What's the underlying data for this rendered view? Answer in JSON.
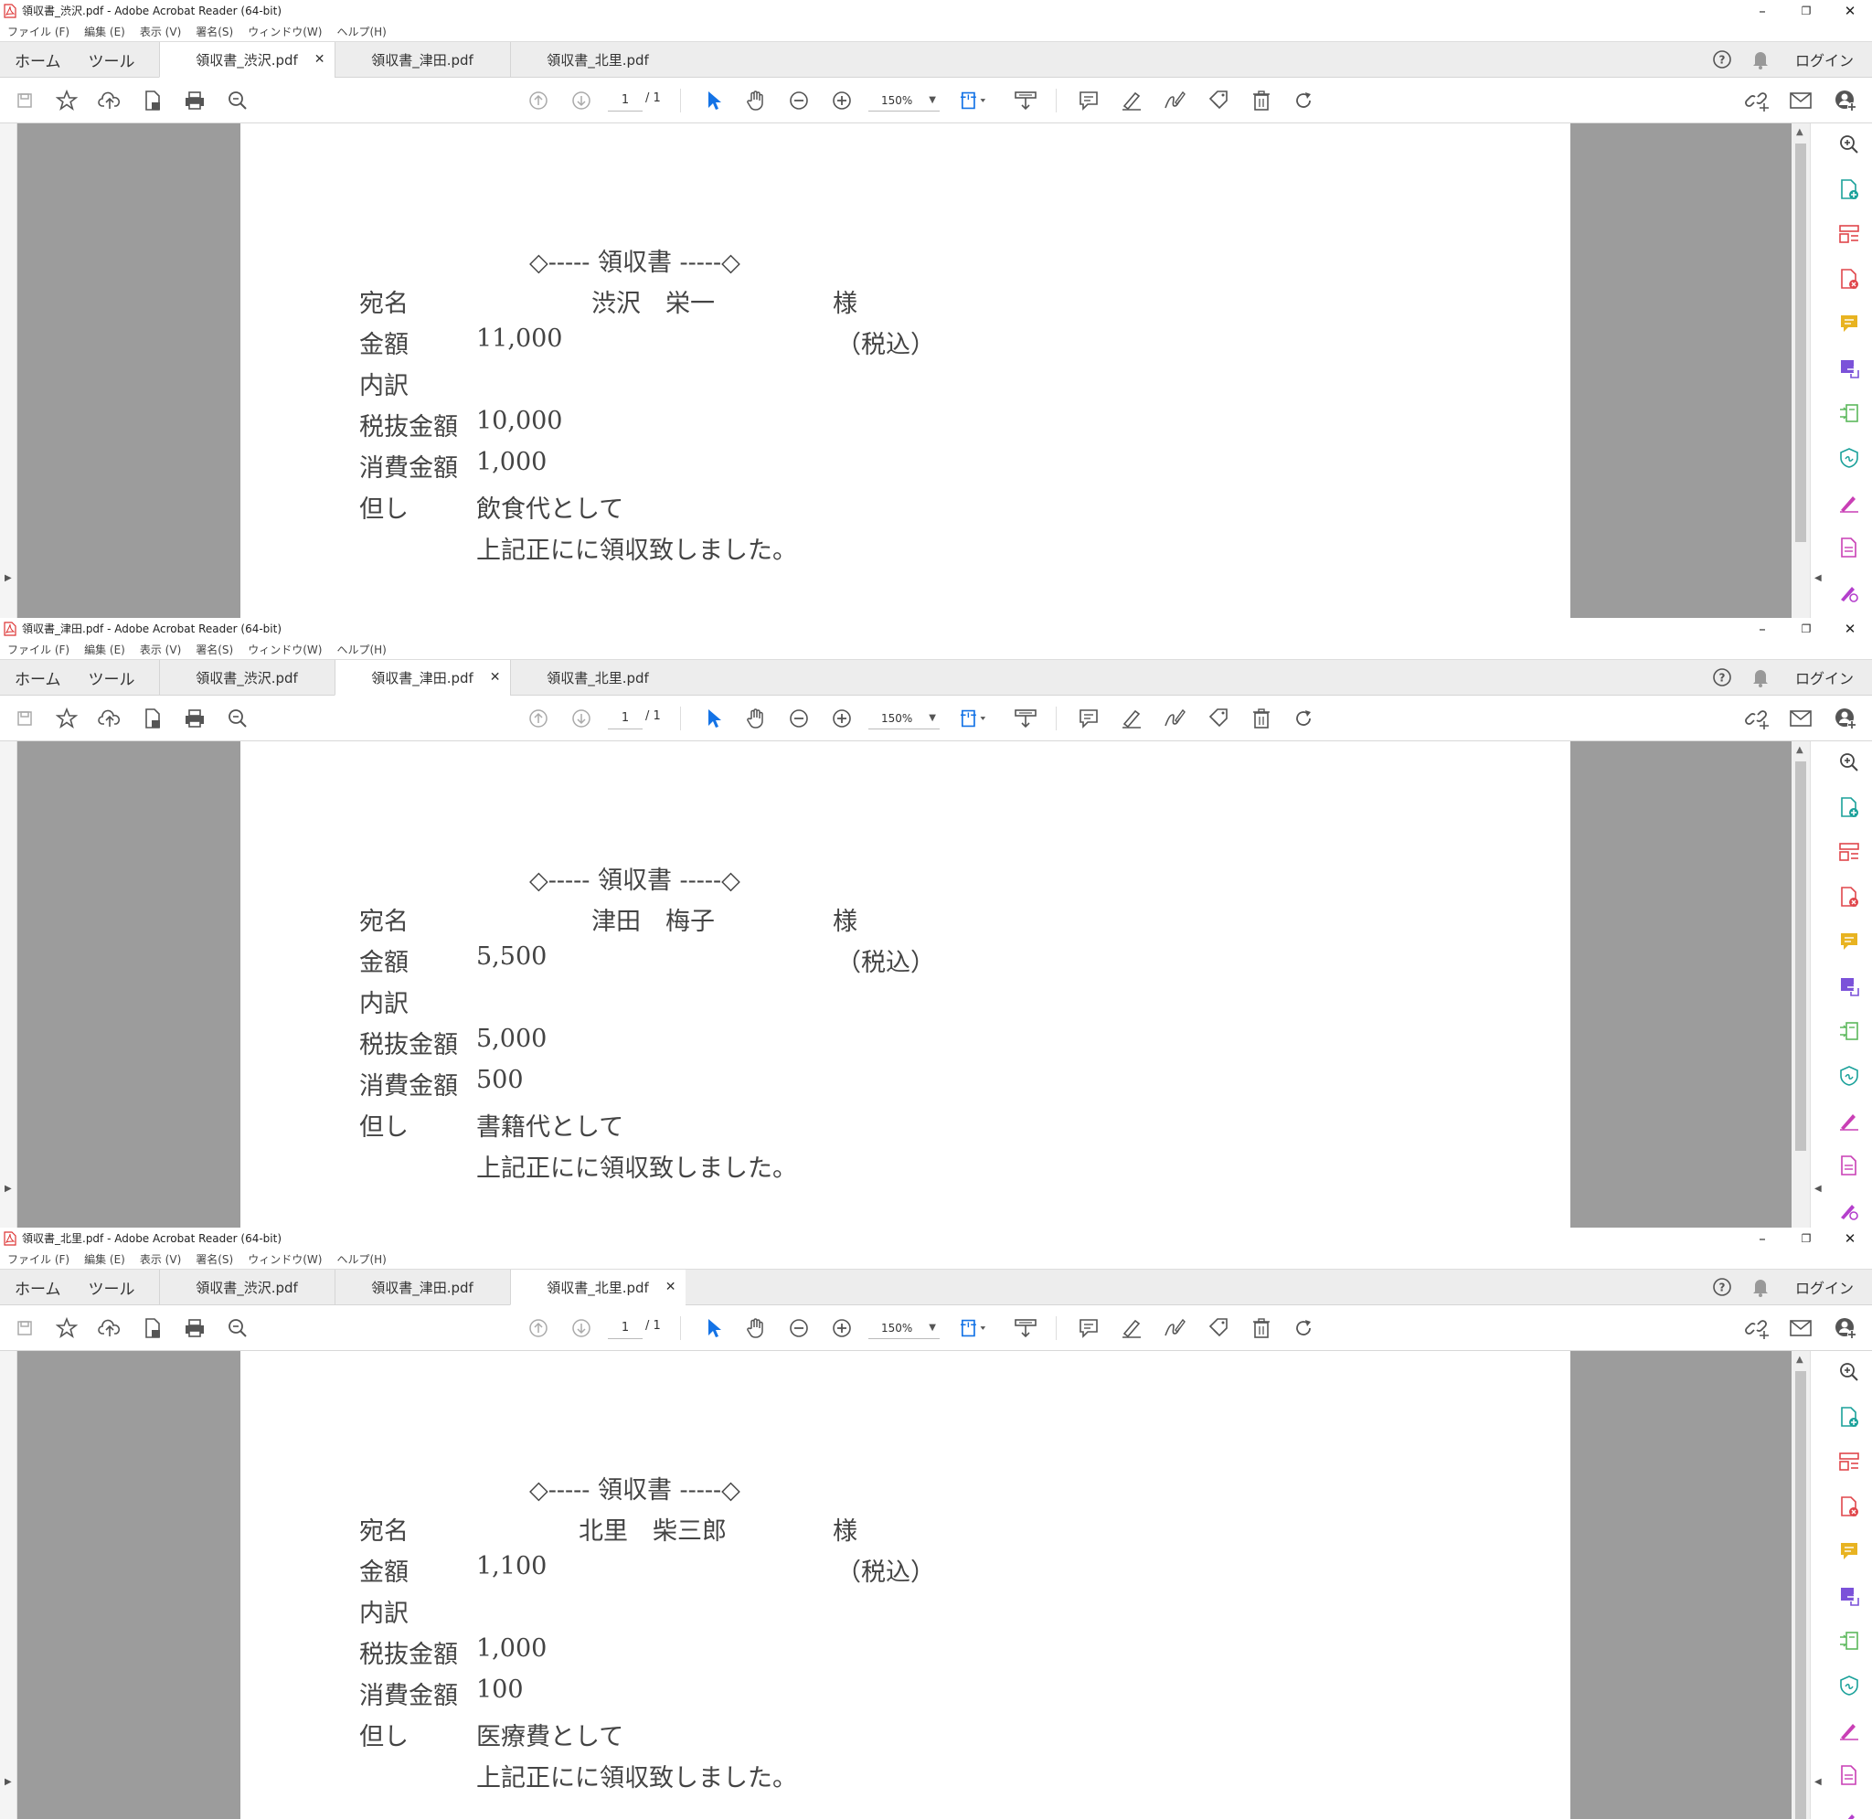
{
  "windows": [
    {
      "title": "領収書_渋沢.pdf - Adobe Acrobat Reader (64-bit)",
      "active_tab": 0,
      "receipt": {
        "name": "渋沢　栄一",
        "amount": "11,000",
        "pretax": "10,000",
        "tax": "1,000",
        "purpose": "飲食代として"
      }
    },
    {
      "title": "領収書_津田.pdf - Adobe Acrobat Reader (64-bit)",
      "active_tab": 1,
      "receipt": {
        "name": "津田　梅子",
        "amount": "5,500",
        "pretax": "5,000",
        "tax": "500",
        "purpose": "書籍代として"
      }
    },
    {
      "title": "領収書_北里.pdf - Adobe Acrobat Reader (64-bit)",
      "active_tab": 2,
      "receipt": {
        "name": "北里　柴三郎",
        "amount": "1,100",
        "pretax": "1,000",
        "tax": "100",
        "purpose": "医療費として"
      }
    }
  ],
  "menu": [
    "ファイル (F)",
    "編集 (E)",
    "表示 (V)",
    "署名(S)",
    "ウィンドウ(W)",
    "ヘルプ(H)"
  ],
  "nav": {
    "home": "ホーム",
    "tools": "ツール",
    "login": "ログイン"
  },
  "tabs": [
    "領収書_渋沢.pdf",
    "領収書_津田.pdf",
    "領収書_北里.pdf"
  ],
  "toolbar": {
    "page_current": "1",
    "page_total": "/ 1",
    "zoom": "150%"
  },
  "receipt_labels": {
    "title": "◇----- 領収書 -----◇",
    "addressee": "宛名",
    "honorific": "様",
    "amount": "金額",
    "tax_included": "（税込）",
    "breakdown": "内訳",
    "pretax": "税抜金額",
    "tax": "消費金額",
    "purpose": "但し",
    "closing": "上記正にに領収致しました。"
  },
  "window_controls": {
    "minimize": "–",
    "restore": "❐",
    "close": "✕"
  },
  "colors": {
    "accent_blue": "#1473e6",
    "teal": "#1aa19a",
    "red": "#e0464b",
    "yellow": "#e8b321",
    "purple": "#7b52d9",
    "green": "#5cb85c",
    "pink": "#c93fb5",
    "magenta": "#b43fcc"
  }
}
